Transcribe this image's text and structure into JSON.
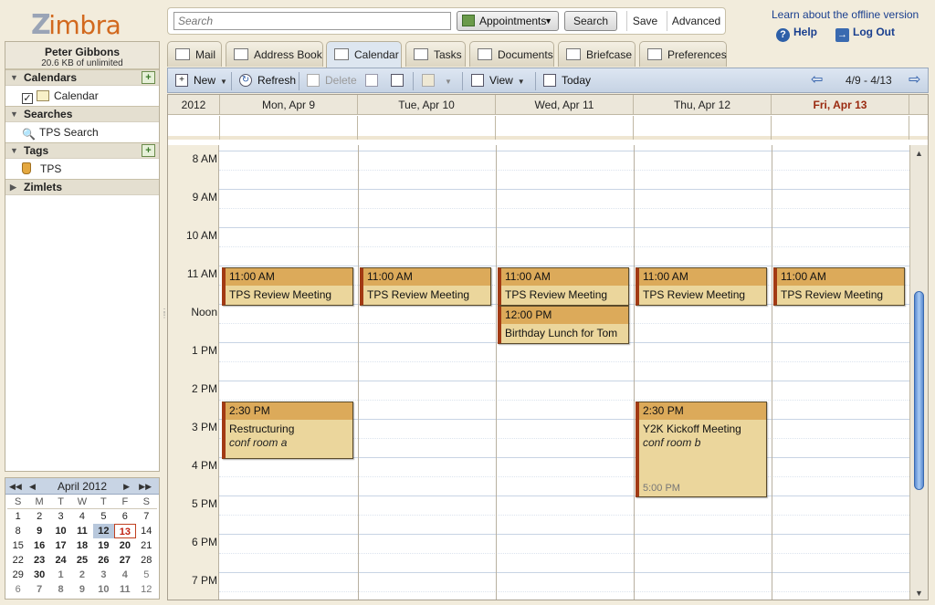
{
  "app": {
    "logo_text": "imbra",
    "logo_z": "Z"
  },
  "search": {
    "placeholder": "Search",
    "value": "",
    "type_label": "Appointments",
    "search_label": "Search",
    "save_label": "Save",
    "advanced_label": "Advanced"
  },
  "topright": {
    "offline_link": "Learn about the offline version",
    "help": "Help",
    "logout": "Log Out"
  },
  "user": {
    "name": "Peter Gibbons",
    "quota": "20.6 KB of unlimited"
  },
  "sidebar": {
    "calendars_header": "Calendars",
    "calendar_item": "Calendar",
    "searches_header": "Searches",
    "search_item": "TPS Search",
    "tags_header": "Tags",
    "tag_item": "TPS",
    "zimlets_header": "Zimlets"
  },
  "minical": {
    "title": "April 2012",
    "dow": [
      "S",
      "M",
      "T",
      "W",
      "T",
      "F",
      "S"
    ],
    "weeks": [
      [
        "1",
        "2",
        "3",
        "4",
        "5",
        "6",
        "7"
      ],
      [
        "8",
        "9",
        "10",
        "11",
        "12",
        "13",
        "14"
      ],
      [
        "15",
        "16",
        "17",
        "18",
        "19",
        "20",
        "21"
      ],
      [
        "22",
        "23",
        "24",
        "25",
        "26",
        "27",
        "28"
      ],
      [
        "29",
        "30",
        "1",
        "2",
        "3",
        "4",
        "5"
      ],
      [
        "6",
        "7",
        "8",
        "9",
        "10",
        "11",
        "12"
      ]
    ]
  },
  "tabs": [
    "Mail",
    "Address Book",
    "Calendar",
    "Tasks",
    "Documents",
    "Briefcase",
    "Preferences"
  ],
  "toolbar": {
    "new": "New",
    "refresh": "Refresh",
    "delete": "Delete",
    "view": "View",
    "today": "Today",
    "range": "4/9 - 4/13"
  },
  "calendar": {
    "year": "2012",
    "days": [
      "Mon, Apr 9",
      "Tue, Apr 10",
      "Wed, Apr 11",
      "Thu, Apr 12",
      "Fri, Apr 13"
    ],
    "hours": [
      "8 AM",
      "9 AM",
      "10 AM",
      "11 AM",
      "Noon",
      "1 PM",
      "2 PM",
      "3 PM",
      "4 PM",
      "5 PM",
      "6 PM",
      "7 PM"
    ],
    "appointments": [
      {
        "time": "11:00 AM",
        "subject": "TPS Review Meeting"
      },
      {
        "time": "11:00 AM",
        "subject": "TPS Review Meeting"
      },
      {
        "time": "11:00 AM",
        "subject": "TPS Review Meeting"
      },
      {
        "time": "12:00 PM",
        "subject": "Birthday Lunch for Tom"
      },
      {
        "time": "11:00 AM",
        "subject": "TPS Review Meeting"
      },
      {
        "time": "11:00 AM",
        "subject": "TPS Review Meeting"
      },
      {
        "time": "2:30 PM",
        "subject": "Restructuring",
        "location": "conf room a"
      },
      {
        "time": "2:30 PM",
        "subject": "Y2K Kickoff Meeting",
        "location": "conf room b",
        "end": "5:00 PM"
      }
    ]
  },
  "colors": {
    "accent": "#2a5aa8",
    "appt_fill": "#ebd69c",
    "appt_header": "#dcaa5a",
    "appt_border": "#a23a14",
    "today": "#9a2a10"
  }
}
